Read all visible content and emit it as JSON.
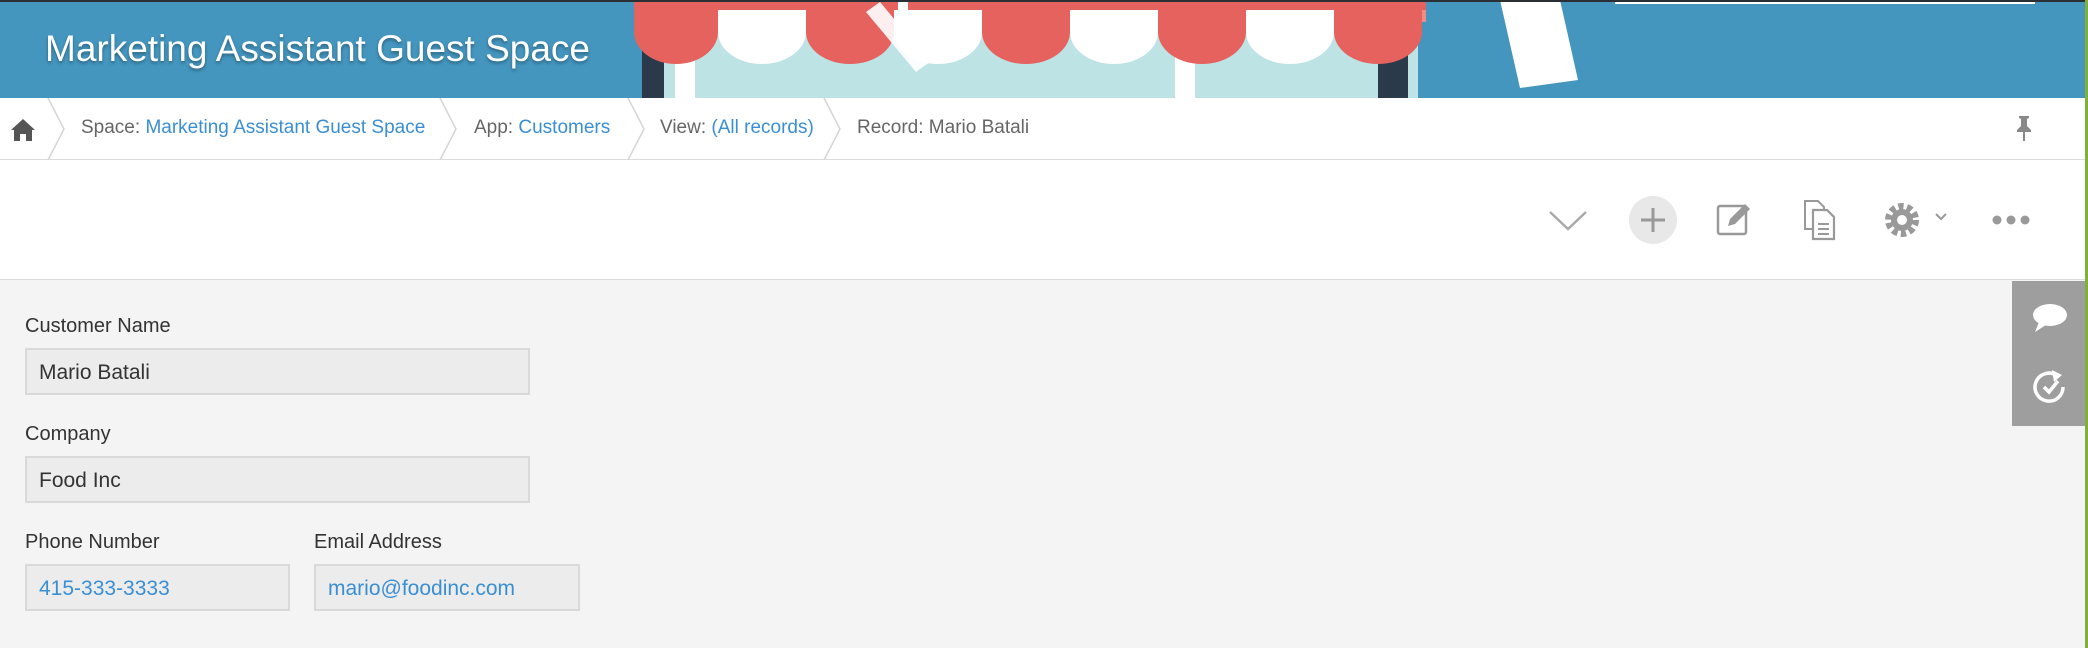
{
  "header": {
    "title": "Marketing Assistant Guest Space"
  },
  "breadcrumb": {
    "space_prefix": "Space: ",
    "space_link": "Marketing Assistant Guest Space",
    "app_prefix": "App: ",
    "app_link": "Customers",
    "view_prefix": "View: ",
    "view_link": "(All records)",
    "record": "Record: Mario Batali"
  },
  "toolbar": {
    "icons": [
      "chevron-down-icon",
      "plus-icon",
      "edit-icon",
      "duplicate-icon",
      "gear-icon",
      "more-icon"
    ]
  },
  "record": {
    "customer_name_label": "Customer Name",
    "customer_name_value": "Mario Batali",
    "company_label": "Company",
    "company_value": "Food Inc",
    "phone_label": "Phone Number",
    "phone_value": "415-333-3333",
    "email_label": "Email Address",
    "email_value": "mario@foodinc.com"
  },
  "side_panel": {
    "icons": [
      "comment-icon",
      "history-icon"
    ]
  },
  "colors": {
    "banner": "#4496bf",
    "link": "#3a8fd4",
    "awning_red": "#e5625f",
    "side_panel": "#9e9e9e"
  }
}
